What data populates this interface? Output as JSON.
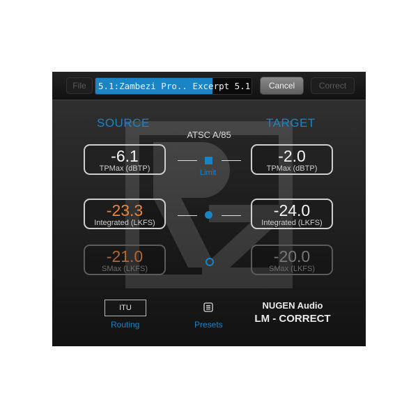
{
  "toolbar": {
    "file_label": "File",
    "filename_selected": "5.1:Zambezi Pro.. Excerpt",
    "filename_rest": " 5.1.wav",
    "cancel_label": "Cancel",
    "correct_label": "Correct"
  },
  "headings": {
    "source": "SOURCE",
    "target": "TARGET",
    "standard": "ATSC A/85"
  },
  "rows": [
    {
      "source_value": "-6.1",
      "source_label": "TPMax (dBTP)",
      "link_label": "Limit",
      "target_value": "-2.0",
      "target_label": "TPMax (dBTP)"
    },
    {
      "source_value": "-23.3",
      "source_label": "Integrated (LKFS)",
      "target_value": "-24.0",
      "target_label": "Integrated (LKFS)"
    },
    {
      "source_value": "-21.0",
      "source_label": "SMax (LKFS)",
      "target_value": "-20.0",
      "target_label": "SMax (LKFS)"
    }
  ],
  "bottom": {
    "itu_label": "ITU",
    "routing_label": "Routing",
    "presets_label": "Presets",
    "brand_line1": "NUGEN Audio",
    "brand_line2": "LM - CORRECT"
  },
  "colors": {
    "accent": "#1b84c4",
    "source_highlight": "#e8843a"
  },
  "icons": {
    "link_square": "square",
    "link_dot": "filled-circle",
    "link_ring": "hollow-circle",
    "presets": "list-icon"
  }
}
